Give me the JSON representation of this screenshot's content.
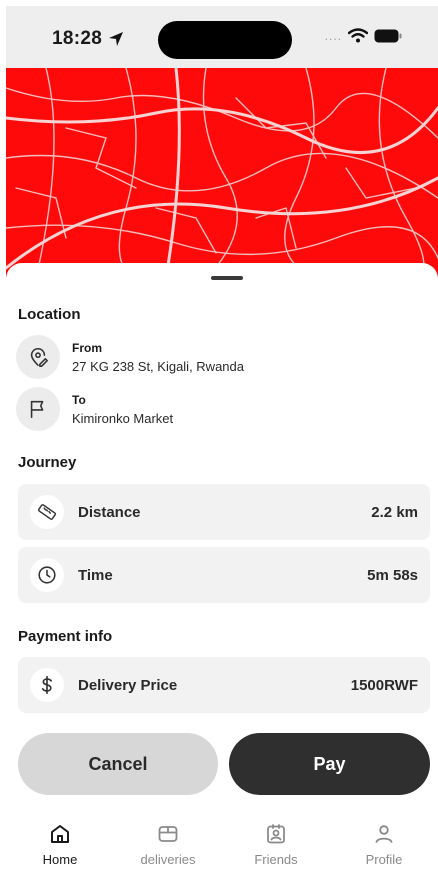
{
  "status_bar": {
    "time": "18:28",
    "signal": "....",
    "icons": [
      "location-arrow-icon",
      "wifi-icon",
      "battery-icon"
    ]
  },
  "map": {
    "accent_color": "#ff0a0a",
    "road_color": "#f4bcbc"
  },
  "location": {
    "title": "Location",
    "from": {
      "label": "From",
      "value": "27 KG 238 St, Kigali, Rwanda",
      "icon": "map-pin-edit-icon"
    },
    "to": {
      "label": "To",
      "value": "Kimironko Market",
      "icon": "flag-icon"
    }
  },
  "journey": {
    "title": "Journey",
    "distance": {
      "label": "Distance",
      "value": "2.2 km",
      "icon": "ruler-icon"
    },
    "time": {
      "label": "Time",
      "value": "5m 58s",
      "icon": "clock-icon"
    }
  },
  "payment": {
    "title": "Payment info",
    "price": {
      "label": "Delivery Price",
      "value": "1500RWF",
      "icon": "dollar-icon"
    }
  },
  "actions": {
    "cancel_label": "Cancel",
    "pay_label": "Pay"
  },
  "tabs": [
    {
      "label": "Home",
      "icon": "home-icon",
      "active": true
    },
    {
      "label": "deliveries",
      "icon": "box-icon",
      "active": false
    },
    {
      "label": "Friends",
      "icon": "contact-card-icon",
      "active": false
    },
    {
      "label": "Profile",
      "icon": "user-icon",
      "active": false
    }
  ]
}
